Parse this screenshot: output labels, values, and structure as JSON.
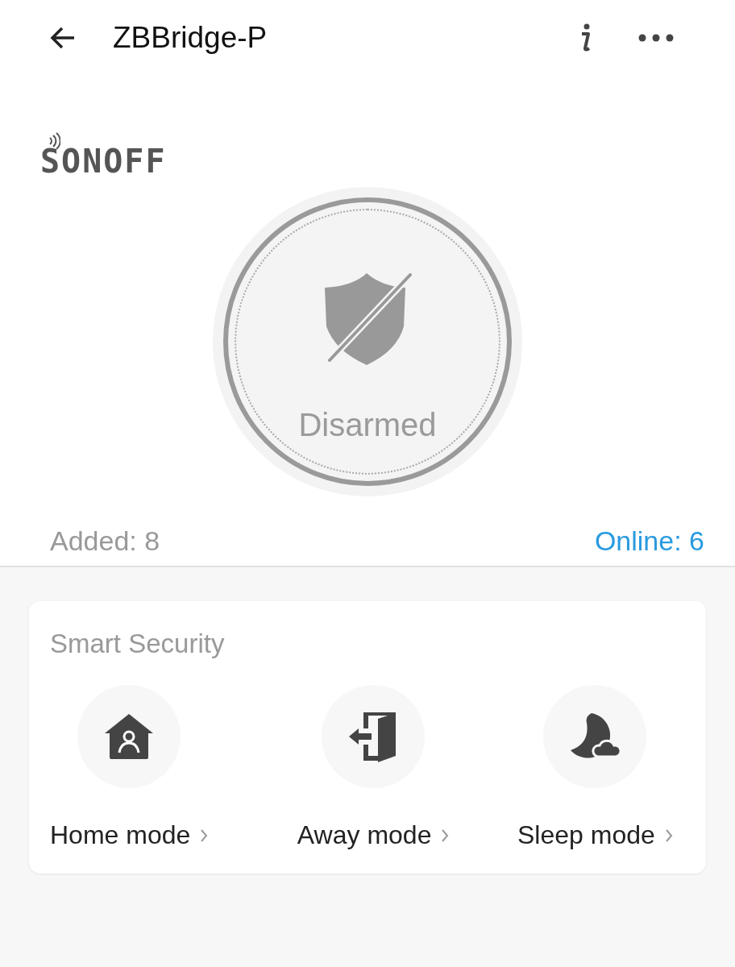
{
  "header": {
    "title": "ZBBridge-P"
  },
  "brand": {
    "logo_text": "SONOFF"
  },
  "status": {
    "label": "Disarmed",
    "armed": false
  },
  "counts": {
    "added": "Added: 8",
    "online": "Online: 6"
  },
  "security": {
    "title": "Smart Security",
    "modes": [
      {
        "kind": "home",
        "label": "Home mode"
      },
      {
        "kind": "away",
        "label": "Away mode"
      },
      {
        "kind": "sleep",
        "label": "Sleep mode"
      }
    ]
  }
}
